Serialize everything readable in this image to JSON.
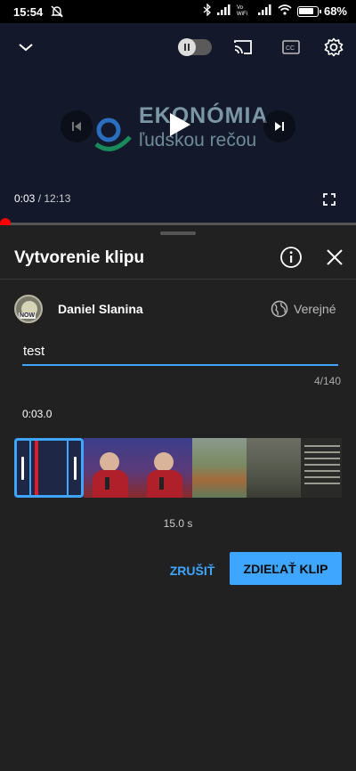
{
  "status_bar": {
    "time": "15:54",
    "battery_percent": "68%",
    "icons": [
      "alarm-off-icon",
      "bluetooth-icon",
      "signal-icon",
      "vowifi-icon",
      "signal-icon",
      "wifi-icon",
      "battery-icon"
    ]
  },
  "player": {
    "logo_title": "EKONÓMIA",
    "logo_subtitle": "ľudskou rečou",
    "current_time": "0:03",
    "duration": "12:13",
    "progress": 0.004,
    "accent": "#ff0000"
  },
  "sheet": {
    "title": "Vytvorenie klipu",
    "channel_name": "Daniel Slanina",
    "avatar_text": "NOW",
    "visibility": "Verejné",
    "clip_title_value": "test",
    "char_counter": "4/140",
    "start_time": "0:03.0",
    "clip_length": "15.0 s",
    "cancel_label": "ZRUŠIŤ",
    "share_label": "ZDIEĽAŤ KLIP",
    "accent": "#3ea6ff"
  }
}
